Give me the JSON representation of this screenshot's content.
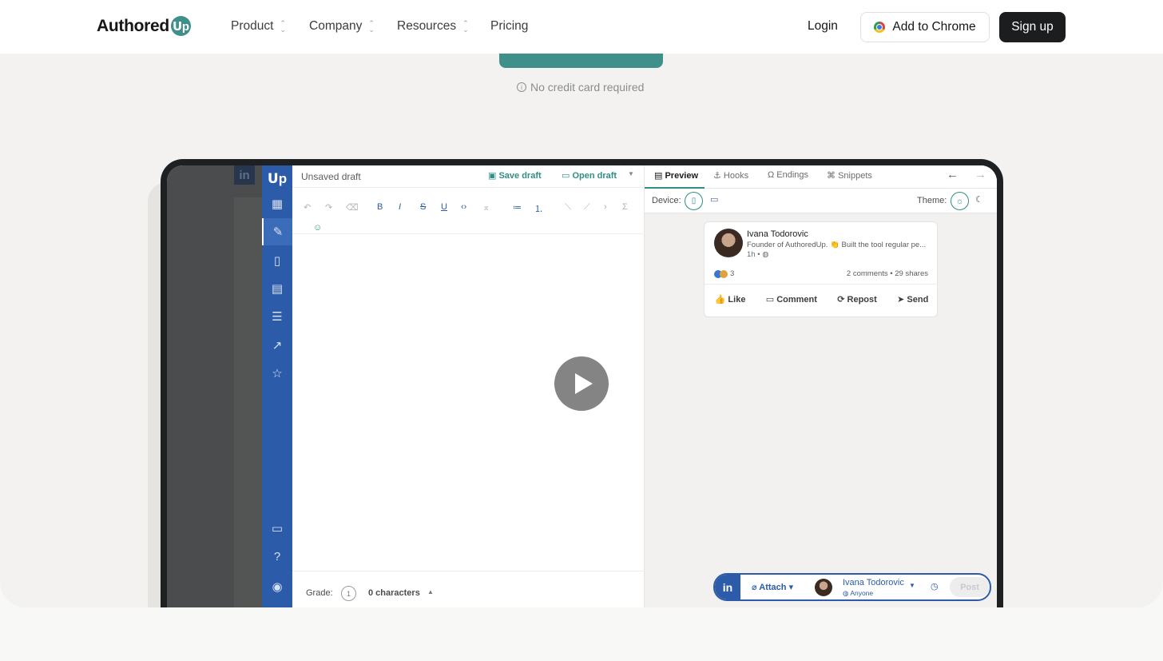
{
  "nav": {
    "logo_text": "Authored",
    "logo_badge": "Up",
    "links": [
      "Product",
      "Company",
      "Resources",
      "Pricing"
    ],
    "login": "Login",
    "add_to_chrome": "Add to Chrome",
    "sign_up": "Sign up"
  },
  "hero": {
    "note": "No credit card required"
  },
  "app": {
    "editor": {
      "title": "Unsaved draft",
      "save": "Save draft",
      "open": "Open draft",
      "grade_label": "Grade:",
      "grade_value": "1",
      "characters": "0 characters"
    },
    "preview": {
      "tabs": [
        "Preview",
        "Hooks",
        "Endings",
        "Snippets"
      ],
      "device_label": "Device:",
      "theme_label": "Theme:",
      "post": {
        "author": "Ivana Todorovic",
        "headline": "Founder of AuthoredUp. 👏 Built the tool regular pe...",
        "time": "1h •",
        "reactions": "3",
        "stats": "2 comments • 29 shares",
        "actions": [
          "Like",
          "Comment",
          "Repost",
          "Send"
        ]
      }
    },
    "post_bar": {
      "attach": "Attach",
      "author": "Ivana Todorovic",
      "audience": "Anyone",
      "post": "Post"
    }
  },
  "colors": {
    "brand_teal": "#3f8f8a",
    "linkedin_blue": "#2c5ca9",
    "dark_button": "#1b1d1f"
  }
}
